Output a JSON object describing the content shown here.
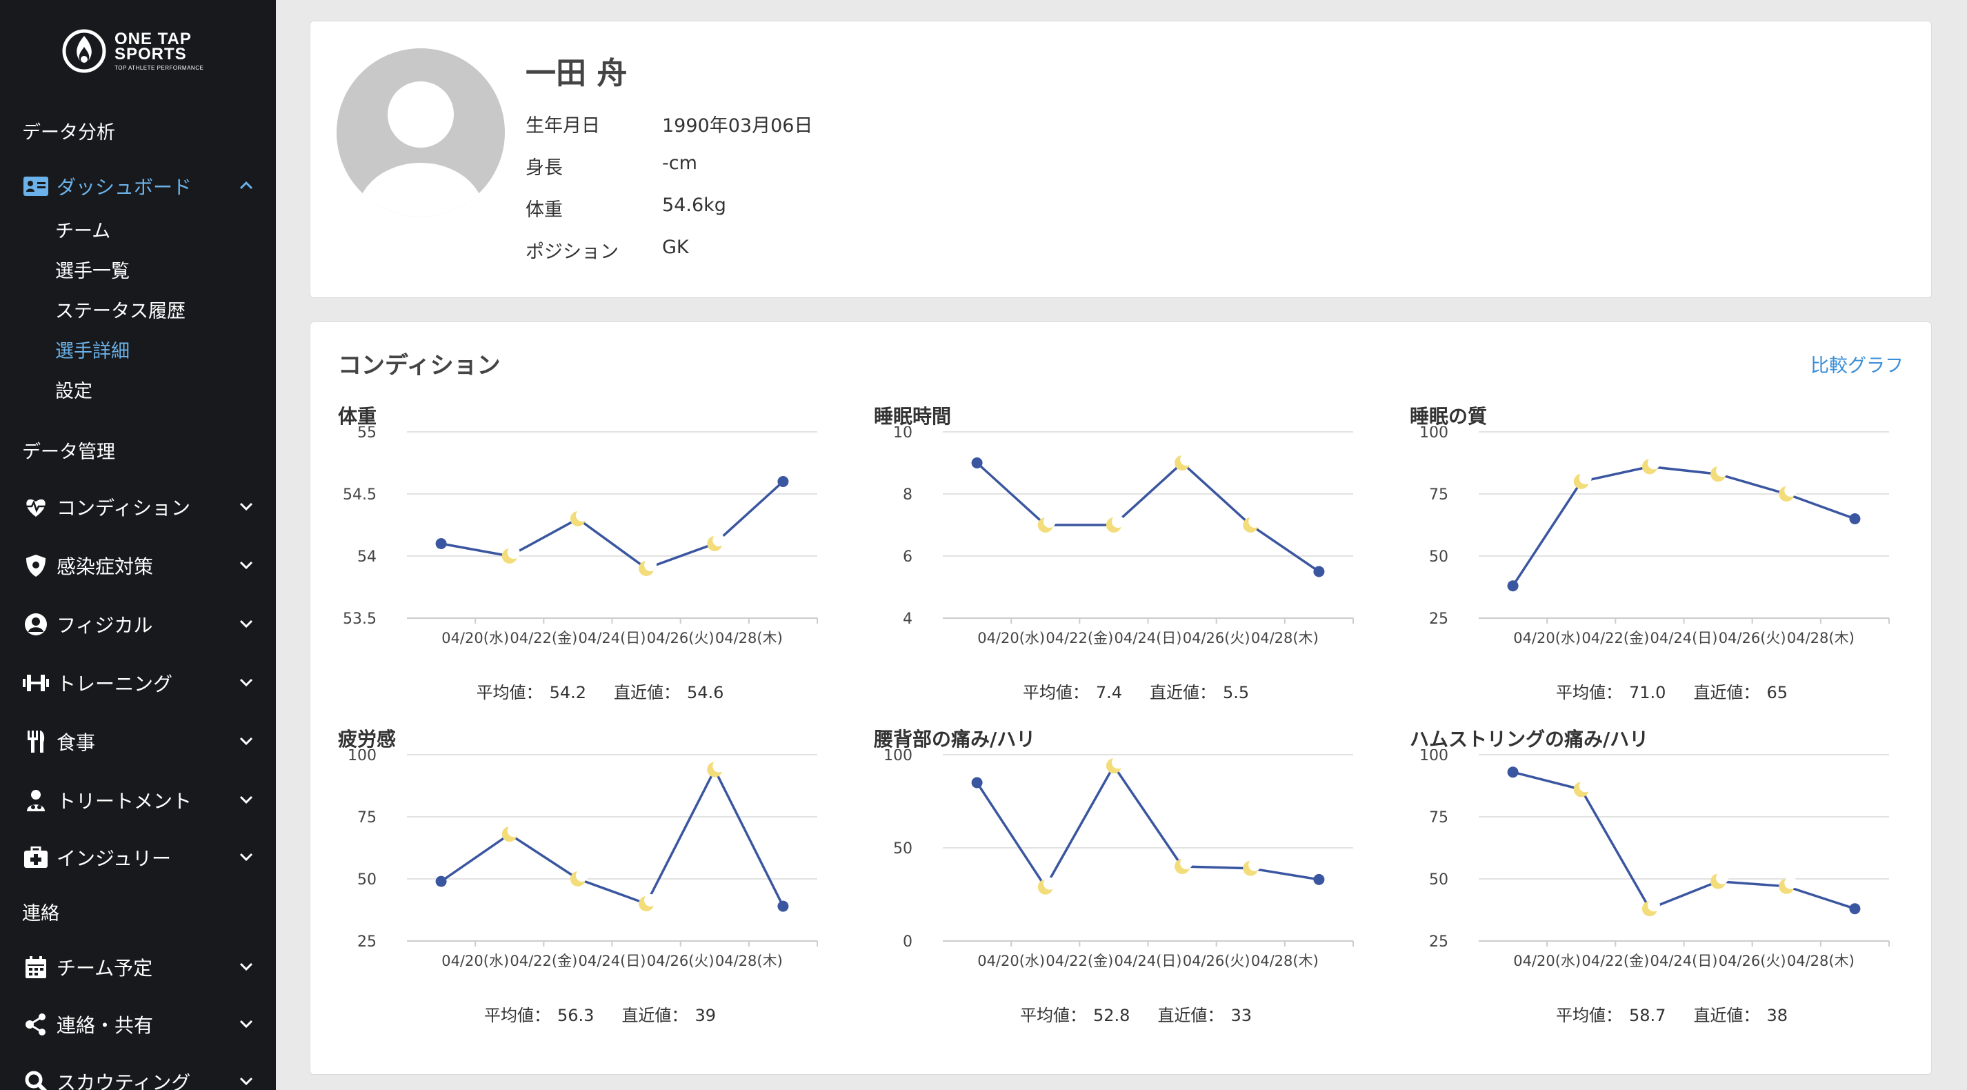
{
  "app": {
    "logo": {
      "title_line1": "ONE TAP",
      "title_line2": "SPORTS",
      "tagline": "TOP ATHLETE PERFORMANCE"
    }
  },
  "sidebar": {
    "section_data_analysis": "データ分析",
    "dashboard": "ダッシュボード",
    "dashboard_sub": [
      "チーム",
      "選手一覧",
      "ステータス履歴",
      "選手詳細",
      "設定"
    ],
    "section_data_management": "データ管理",
    "management_items": [
      "コンディション",
      "感染症対策",
      "フィジカル",
      "トレーニング",
      "食事",
      "トリートメント",
      "インジュリー"
    ],
    "section_contact": "連絡",
    "contact_items": [
      "チーム予定",
      "連絡・共有",
      "スカウティング"
    ]
  },
  "profile": {
    "name": "一田 舟",
    "fields": [
      {
        "label": "生年月日",
        "value": "1990年03月06日"
      },
      {
        "label": "身長",
        "value": "-cm"
      },
      {
        "label": "体重",
        "value": "54.6kg"
      },
      {
        "label": "ポジション",
        "value": "GK"
      }
    ]
  },
  "condition": {
    "title": "コンディション",
    "compare_link": "比較グラフ",
    "avg_label": "平均値：",
    "latest_label": "直近値："
  },
  "colors": {
    "line": "#3a56a0",
    "accent": "#6cb2ea",
    "moon": "#f3dc7a"
  },
  "chart_data": [
    {
      "type": "line",
      "title": "体重",
      "x_labels": [
        "04/20(水)",
        "04/22(金)",
        "04/24(日)",
        "04/26(火)",
        "04/28(木)"
      ],
      "values": [
        54.1,
        54.0,
        54.3,
        53.9,
        54.1,
        54.6
      ],
      "markers": [
        "dot",
        "moon",
        "moon",
        "moon",
        "moon",
        "dot"
      ],
      "y_ticks": [
        "55",
        "54.5",
        "54",
        "53.5"
      ],
      "ylim": [
        53.5,
        55
      ],
      "average": "54.2",
      "latest": "54.6"
    },
    {
      "type": "line",
      "title": "睡眠時間",
      "x_labels": [
        "04/20(水)",
        "04/22(金)",
        "04/24(日)",
        "04/26(火)",
        "04/28(木)"
      ],
      "values": [
        9,
        7,
        7,
        9,
        7,
        5.5
      ],
      "markers": [
        "dot",
        "moon",
        "moon",
        "moon",
        "moon",
        "dot"
      ],
      "y_ticks": [
        "10",
        "8",
        "6",
        "4"
      ],
      "ylim": [
        4,
        10
      ],
      "average": "7.4",
      "latest": "5.5"
    },
    {
      "type": "line",
      "title": "睡眠の質",
      "x_labels": [
        "04/20(水)",
        "04/22(金)",
        "04/24(日)",
        "04/26(火)",
        "04/28(木)"
      ],
      "values": [
        38,
        80,
        86,
        83,
        75,
        65
      ],
      "markers": [
        "dot",
        "moon",
        "moon",
        "moon",
        "moon",
        "dot"
      ],
      "y_ticks": [
        "100",
        "75",
        "50",
        "25"
      ],
      "ylim": [
        25,
        100
      ],
      "average": "71.0",
      "latest": "65"
    },
    {
      "type": "line",
      "title": "疲労感",
      "x_labels": [
        "04/20(水)",
        "04/22(金)",
        "04/24(日)",
        "04/26(火)",
        "04/28(木)"
      ],
      "values": [
        49,
        68,
        50,
        40,
        94,
        39
      ],
      "markers": [
        "dot",
        "moon",
        "moon",
        "moon",
        "moon",
        "dot"
      ],
      "y_ticks": [
        "100",
        "75",
        "50",
        "25"
      ],
      "ylim": [
        25,
        100
      ],
      "average": "56.3",
      "latest": "39"
    },
    {
      "type": "line",
      "title": "腰背部の痛み/ハリ",
      "x_labels": [
        "04/20(水)",
        "04/22(金)",
        "04/24(日)",
        "04/26(火)",
        "04/28(木)"
      ],
      "values": [
        85,
        29,
        94,
        40,
        39,
        33
      ],
      "markers": [
        "dot",
        "moon",
        "moon",
        "moon",
        "moon",
        "dot"
      ],
      "y_ticks": [
        "100",
        "50",
        "0"
      ],
      "ylim": [
        0,
        100
      ],
      "average": "52.8",
      "latest": "33"
    },
    {
      "type": "line",
      "title": "ハムストリングの痛み/ハリ",
      "x_labels": [
        "04/20(水)",
        "04/22(金)",
        "04/24(日)",
        "04/26(火)",
        "04/28(木)"
      ],
      "values": [
        93,
        86,
        38,
        49,
        47,
        38
      ],
      "markers": [
        "dot",
        "moon",
        "moon",
        "moon",
        "moon",
        "dot"
      ],
      "y_ticks": [
        "100",
        "75",
        "50",
        "25"
      ],
      "ylim": [
        25,
        100
      ],
      "average": "58.7",
      "latest": "38"
    }
  ]
}
